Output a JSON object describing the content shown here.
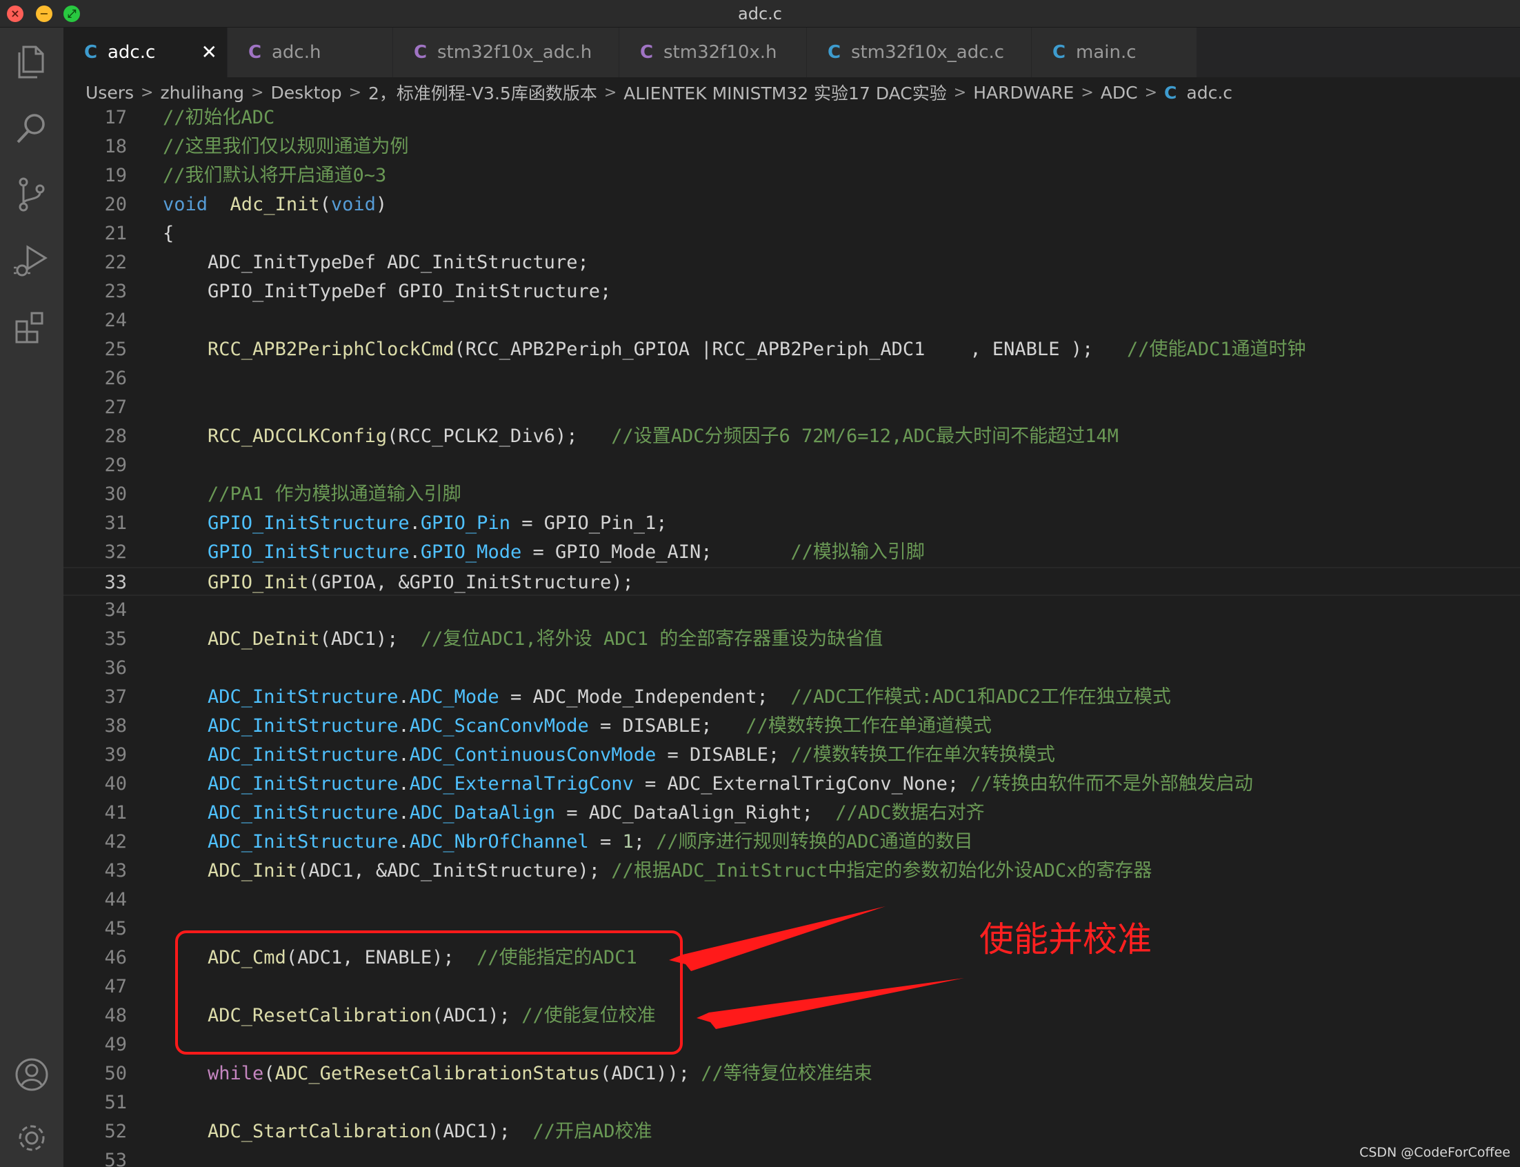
{
  "window": {
    "title": "adc.c"
  },
  "tabs": [
    {
      "icon": "C",
      "label": "adc.c",
      "active": true,
      "close": "✕"
    },
    {
      "icon": "C",
      "label": "adc.h"
    },
    {
      "icon": "C",
      "label": "stm32f10x_adc.h"
    },
    {
      "icon": "C",
      "label": "stm32f10x.h"
    },
    {
      "icon": "C",
      "label": "stm32f10x_adc.c"
    },
    {
      "icon": "C",
      "label": "main.c"
    }
  ],
  "breadcrumb": {
    "items": [
      "Users",
      "zhulihang",
      "Desktop",
      "2，标准例程-V3.5库函数版本",
      "ALIENTEK MINISTM32 实验17 DAC实验",
      "HARDWARE",
      "ADC"
    ],
    "file_icon": "C",
    "file": "adc.c"
  },
  "code": {
    "line_numbers": [
      "17",
      "18",
      "19",
      "20",
      "21",
      "22",
      "23",
      "24",
      "25",
      "26",
      "27",
      "28",
      "29",
      "30",
      "31",
      "32",
      "33",
      "34",
      "35",
      "36",
      "37",
      "38",
      "39",
      "40",
      "41",
      "42",
      "43",
      "44",
      "45",
      "46",
      "47",
      "48",
      "49",
      "50",
      "51",
      "52",
      "53"
    ],
    "current_line": "33",
    "lines": [
      [
        [
          "cm",
          "//初始化ADC"
        ]
      ],
      [
        [
          "cm",
          "//这里我们仅以规则通道为例"
        ]
      ],
      [
        [
          "cm",
          "//我们默认将开启通道0~3"
        ]
      ],
      [
        [
          "k",
          "void"
        ],
        [
          "p",
          "  "
        ],
        [
          "f",
          "Adc_Init"
        ],
        [
          "p",
          "("
        ],
        [
          "k",
          "void"
        ],
        [
          "p",
          ")"
        ]
      ],
      [
        [
          "p",
          "{"
        ]
      ],
      [
        [
          "p",
          "    ADC_InitTypeDef ADC_InitStructure;"
        ]
      ],
      [
        [
          "p",
          "    GPIO_InitTypeDef GPIO_InitStructure;"
        ]
      ],
      [],
      [
        [
          "p",
          "    "
        ],
        [
          "f",
          "RCC_APB2PeriphClockCmd"
        ],
        [
          "p",
          "(RCC_APB2Periph_GPIOA |RCC_APB2Periph_ADC1    , ENABLE );   "
        ],
        [
          "cm",
          "//使能ADC1通道时钟"
        ]
      ],
      [],
      [],
      [
        [
          "p",
          "    "
        ],
        [
          "f",
          "RCC_ADCCLKConfig"
        ],
        [
          "p",
          "(RCC_PCLK2_Div6);   "
        ],
        [
          "cm",
          "//设置ADC分频因子6 72M/6=12,ADC最大时间不能超过14M"
        ]
      ],
      [],
      [
        [
          "p",
          "    "
        ],
        [
          "cm",
          "//PA1 作为模拟通道输入引脚"
        ]
      ],
      [
        [
          "p",
          "    "
        ],
        [
          "v",
          "GPIO_InitStructure"
        ],
        [
          "p",
          "."
        ],
        [
          "v",
          "GPIO_Pin"
        ],
        [
          "p",
          " = GPIO_Pin_1;"
        ]
      ],
      [
        [
          "p",
          "    "
        ],
        [
          "v",
          "GPIO_InitStructure"
        ],
        [
          "p",
          "."
        ],
        [
          "v",
          "GPIO_Mode"
        ],
        [
          "p",
          " = GPIO_Mode_AIN;       "
        ],
        [
          "cm",
          "//模拟输入引脚"
        ]
      ],
      [
        [
          "p",
          "    "
        ],
        [
          "f",
          "GPIO_Init"
        ],
        [
          "p",
          "(GPIOA, &GPIO_InitStructure);"
        ]
      ],
      [],
      [
        [
          "p",
          "    "
        ],
        [
          "f",
          "ADC_DeInit"
        ],
        [
          "p",
          "(ADC1);  "
        ],
        [
          "cm",
          "//复位ADC1,将外设 ADC1 的全部寄存器重设为缺省值"
        ]
      ],
      [],
      [
        [
          "p",
          "    "
        ],
        [
          "v",
          "ADC_InitStructure"
        ],
        [
          "p",
          "."
        ],
        [
          "v",
          "ADC_Mode"
        ],
        [
          "p",
          " = ADC_Mode_Independent;  "
        ],
        [
          "cm",
          "//ADC工作模式:ADC1和ADC2工作在独立模式"
        ]
      ],
      [
        [
          "p",
          "    "
        ],
        [
          "v",
          "ADC_InitStructure"
        ],
        [
          "p",
          "."
        ],
        [
          "v",
          "ADC_ScanConvMode"
        ],
        [
          "p",
          " = DISABLE;   "
        ],
        [
          "cm",
          "//模数转换工作在单通道模式"
        ]
      ],
      [
        [
          "p",
          "    "
        ],
        [
          "v",
          "ADC_InitStructure"
        ],
        [
          "p",
          "."
        ],
        [
          "v",
          "ADC_ContinuousConvMode"
        ],
        [
          "p",
          " = DISABLE; "
        ],
        [
          "cm",
          "//模数转换工作在单次转换模式"
        ]
      ],
      [
        [
          "p",
          "    "
        ],
        [
          "v",
          "ADC_InitStructure"
        ],
        [
          "p",
          "."
        ],
        [
          "v",
          "ADC_ExternalTrigConv"
        ],
        [
          "p",
          " = ADC_ExternalTrigConv_None; "
        ],
        [
          "cm",
          "//转换由软件而不是外部触发启动"
        ]
      ],
      [
        [
          "p",
          "    "
        ],
        [
          "v",
          "ADC_InitStructure"
        ],
        [
          "p",
          "."
        ],
        [
          "v",
          "ADC_DataAlign"
        ],
        [
          "p",
          " = ADC_DataAlign_Right;  "
        ],
        [
          "cm",
          "//ADC数据右对齐"
        ]
      ],
      [
        [
          "p",
          "    "
        ],
        [
          "v",
          "ADC_InitStructure"
        ],
        [
          "p",
          "."
        ],
        [
          "v",
          "ADC_NbrOfChannel"
        ],
        [
          "p",
          " = "
        ],
        [
          "nm",
          "1"
        ],
        [
          "p",
          "; "
        ],
        [
          "cm",
          "//顺序进行规则转换的ADC通道的数目"
        ]
      ],
      [
        [
          "p",
          "    "
        ],
        [
          "f",
          "ADC_Init"
        ],
        [
          "p",
          "(ADC1, &ADC_InitStructure); "
        ],
        [
          "cm",
          "//根据ADC_InitStruct中指定的参数初始化外设ADCx的寄存器"
        ]
      ],
      [],
      [],
      [
        [
          "p",
          "    "
        ],
        [
          "f",
          "ADC_Cmd"
        ],
        [
          "p",
          "(ADC1, ENABLE);  "
        ],
        [
          "cm",
          "//使能指定的ADC1"
        ]
      ],
      [],
      [
        [
          "p",
          "    "
        ],
        [
          "f",
          "ADC_ResetCalibration"
        ],
        [
          "p",
          "(ADC1); "
        ],
        [
          "cm",
          "//使能复位校准"
        ]
      ],
      [],
      [
        [
          "p",
          "    "
        ],
        [
          "kw",
          "while"
        ],
        [
          "p",
          "("
        ],
        [
          "f",
          "ADC_GetResetCalibrationStatus"
        ],
        [
          "p",
          "(ADC1)); "
        ],
        [
          "cm",
          "//等待复位校准结束"
        ]
      ],
      [],
      [
        [
          "p",
          "    "
        ],
        [
          "f",
          "ADC_StartCalibration"
        ],
        [
          "p",
          "(ADC1);  "
        ],
        [
          "cm",
          "//开启AD校准"
        ]
      ],
      []
    ]
  },
  "annotation": {
    "label": "使能并校准",
    "color": "#ff1a1a"
  },
  "watermark": "CSDN @CodeForCoffee",
  "icons": {
    "activity_bar": [
      "files-icon",
      "search-icon",
      "source-control-icon",
      "run-debug-icon",
      "extensions-icon",
      "account-icon",
      "settings-gear-icon"
    ]
  },
  "colors": {
    "editor_bg": "#1e1e1e",
    "comment": "#6a9955",
    "keyword": "#569cd6",
    "function": "#dcdcaa",
    "variable": "#4fc1ff",
    "control": "#c586c0"
  }
}
